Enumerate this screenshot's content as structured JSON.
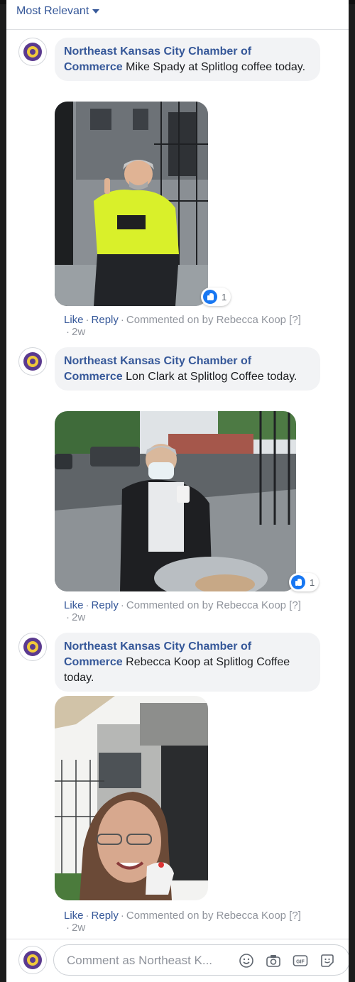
{
  "sort": {
    "label": "Most Relevant"
  },
  "comments": [
    {
      "author": "Northeast Kansas City Chamber of Commerce",
      "text": "Mike Spady at Splitlog coffee today.",
      "reaction_count": "1",
      "like": "Like",
      "reply": "Reply",
      "commented_by": "Commented on by Rebecca Koop",
      "help": "[?]",
      "time": "2w"
    },
    {
      "author": "Northeast Kansas City Chamber of Commerce",
      "text": "Lon Clark at Splitlog Coffee today.",
      "reaction_count": "1",
      "like": "Like",
      "reply": "Reply",
      "commented_by": "Commented on by Rebecca Koop",
      "help": "[?]",
      "time": "2w"
    },
    {
      "author": "Northeast Kansas City Chamber of Commerce",
      "text": "Rebecca Koop at Splitlog Coffee today.",
      "like": "Like",
      "reply": "Reply",
      "commented_by": "Commented on by Rebecca Koop",
      "help": "[?]",
      "time": "2w"
    }
  ],
  "composer": {
    "placeholder": "Comment as Northeast K...",
    "icons": [
      "emoji-icon",
      "camera-icon",
      "gif-icon",
      "sticker-icon"
    ]
  },
  "colors": {
    "link": "#365899",
    "like_blue": "#1877f2",
    "bubble": "#f2f3f5",
    "meta": "#90949c"
  }
}
